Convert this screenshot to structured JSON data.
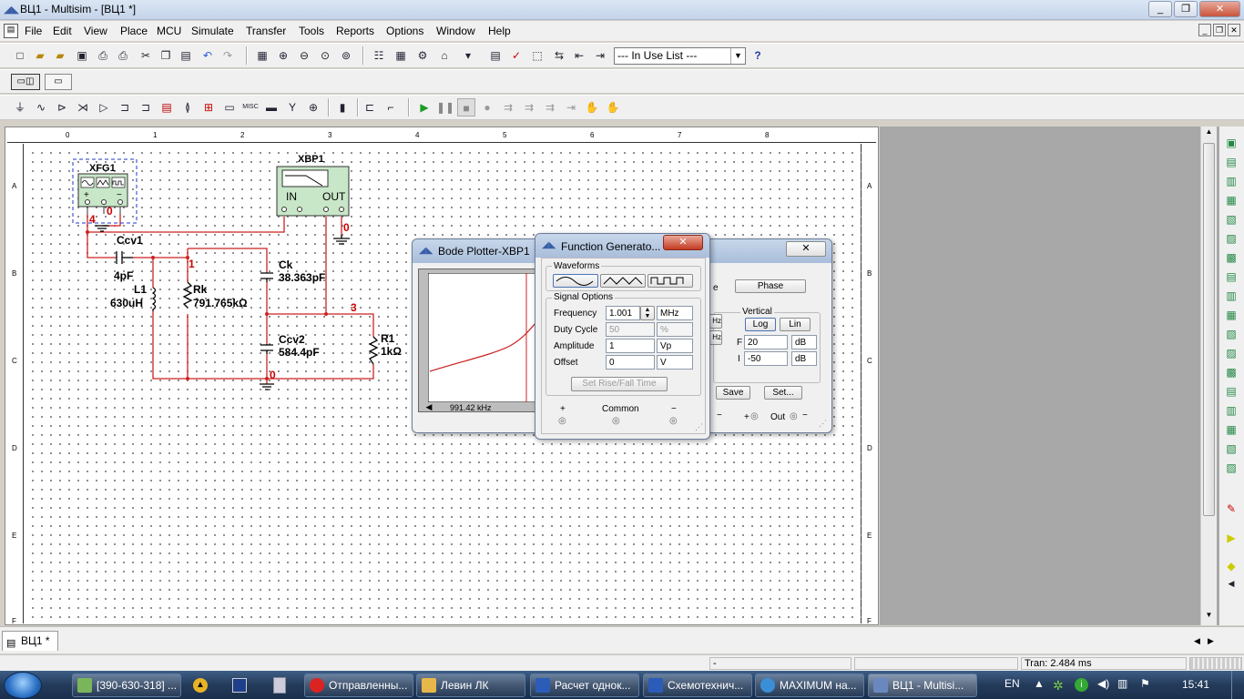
{
  "window": {
    "title": "ВЦ1 - Multisim - [ВЦ1 *]"
  },
  "menu": [
    "File",
    "Edit",
    "View",
    "Place",
    "MCU",
    "Simulate",
    "Transfer",
    "Tools",
    "Reports",
    "Options",
    "Window",
    "Help"
  ],
  "toolbar": {
    "in_use_list": "--- In Use List ---",
    "help_glyph": "?"
  },
  "ruler": {
    "cols": [
      "0",
      "1",
      "2",
      "3",
      "4",
      "5",
      "6",
      "7",
      "8"
    ],
    "rows": [
      "A",
      "B",
      "C",
      "D",
      "E",
      "F"
    ]
  },
  "instruments": {
    "xfg_label": "XFG1",
    "xfg_plus": "+",
    "xfg_common": "0",
    "xfg_minus": "−",
    "xbp_label": "XBP1",
    "xbp_in": "IN",
    "xbp_out": "OUT"
  },
  "components": {
    "ccv1": "Ccv1",
    "ccv1_value": "4pF",
    "l1": "L1",
    "l1_value": "630uH",
    "rk": "Rk",
    "rk_value": "791.765kΩ",
    "ck": "Ck",
    "ck_value": "38.363pF",
    "ccv2": "Ccv2",
    "ccv2_value": "584.4pF",
    "r1": "R1",
    "r1_value": "1kΩ"
  },
  "nets": {
    "n4": "4",
    "n1": "1",
    "n3": "3",
    "n0a": "0",
    "n0b": "0",
    "n0c": "0"
  },
  "bode": {
    "title": "Bode Plotter-XBP1",
    "freq_readout": "991.42 kHz",
    "phase_label": "Phase",
    "mode_label_partial": "e",
    "vertical_label": "Vertical",
    "log_label": "Log",
    "lin_label": "Lin",
    "f_label": "F",
    "f_value": "20",
    "f_unit": "dB",
    "i_label": "I",
    "i_value": "-50",
    "i_unit": "dB",
    "hz1_partial": "Hz",
    "hz2_partial": "Hz",
    "save_label": "Save",
    "set_label": "Set...",
    "minus_partial": "−",
    "plus_in": "+",
    "out_label": "Out",
    "minus_out": "−",
    "close_glyph": "✕"
  },
  "fg": {
    "title": "Function Generato...",
    "waveforms_label": "Waveforms",
    "signal_options_label": "Signal Options",
    "frequency_label": "Frequency",
    "frequency_value": "1.001",
    "frequency_unit": "MHz",
    "duty_label": "Duty Cycle",
    "duty_value": "50",
    "duty_unit": "%",
    "amplitude_label": "Amplitude",
    "amplitude_value": "1",
    "amplitude_unit": "Vp",
    "offset_label": "Offset",
    "offset_value": "0",
    "offset_unit": "V",
    "rise_fall_label": "Set Rise/Fall Time",
    "plus_label": "+",
    "common_label": "Common",
    "minus_label": "−",
    "close_glyph": "✕"
  },
  "tabs": {
    "sheet": "ВЦ1 *"
  },
  "status": {
    "left": "-",
    "tran": "Tran: 2.484 ms"
  },
  "taskbar": {
    "items": [
      {
        "label": "[390-630-318] ...",
        "color": "#7ab55c"
      },
      {
        "label": "Отправленны...",
        "color": "#d22"
      },
      {
        "label": "Левин ЛК",
        "color": "#e6b84a"
      },
      {
        "label": "Расчет однок...",
        "color": "#2b5cb8"
      },
      {
        "label": "Схемотехнич...",
        "color": "#2b5cb8"
      },
      {
        "label": "MAXIMUM на...",
        "color": "#3a8fd8"
      },
      {
        "label": "ВЦ1 - Multisi...",
        "color": "#6a88c0"
      }
    ],
    "lang": "EN",
    "clock": "15:41"
  },
  "colors": {
    "wire": "#cc2222",
    "instrument": "#c8e6c8",
    "net": "#cc0000"
  }
}
